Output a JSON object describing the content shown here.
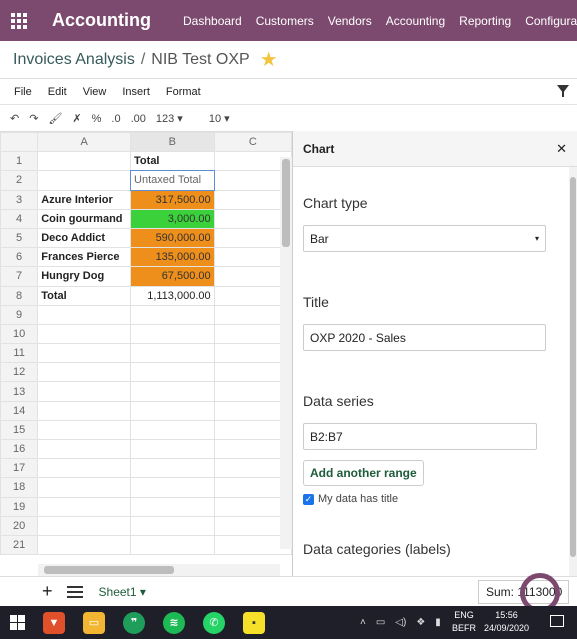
{
  "app": {
    "title": "Accounting",
    "nav": [
      "Dashboard",
      "Customers",
      "Vendors",
      "Accounting",
      "Reporting",
      "Configurati"
    ]
  },
  "breadcrumb": {
    "parent": "Invoices Analysis",
    "separator": "/",
    "current": "NIB Test OXP"
  },
  "menu": [
    "File",
    "Edit",
    "View",
    "Insert",
    "Format"
  ],
  "toolbar": {
    "percent": "%",
    "dec_less": ".0",
    "dec_more": ".00",
    "format": "123 ▾",
    "font_size": "10 ▾"
  },
  "sheet": {
    "columns": [
      "A",
      "B",
      "C"
    ],
    "rows": [
      {
        "n": "1",
        "a": "",
        "b": "Total"
      },
      {
        "n": "2",
        "a": "",
        "b": "Untaxed Total"
      },
      {
        "n": "3",
        "a": "Azure Interior",
        "b": "317,500.00"
      },
      {
        "n": "4",
        "a": "Coin gourmand",
        "b": "3,000.00"
      },
      {
        "n": "5",
        "a": "Deco Addict",
        "b": "590,000.00"
      },
      {
        "n": "6",
        "a": "Frances Pierce",
        "b": "135,000.00"
      },
      {
        "n": "7",
        "a": "Hungry Dog",
        "b": "67,500.00"
      },
      {
        "n": "8",
        "a": "Total",
        "b": "1,113,000.00"
      },
      {
        "n": "9"
      },
      {
        "n": "10"
      },
      {
        "n": "11"
      },
      {
        "n": "12"
      },
      {
        "n": "13"
      },
      {
        "n": "14"
      },
      {
        "n": "15"
      },
      {
        "n": "16"
      },
      {
        "n": "17"
      },
      {
        "n": "18"
      },
      {
        "n": "19"
      },
      {
        "n": "20"
      },
      {
        "n": "21"
      }
    ]
  },
  "panel": {
    "title": "Chart",
    "chart_type_label": "Chart type",
    "chart_type_value": "Bar",
    "title_label": "Title",
    "title_value": "OXP 2020 - Sales",
    "series_label": "Data series",
    "series_value": "B2:B7",
    "add_range": "Add another range",
    "has_title": "My data has title",
    "categories_label": "Data categories (labels)"
  },
  "bottom": {
    "add": "+",
    "sheet_tab": "Sheet1 ▾",
    "sum": "Sum: 1113000"
  },
  "taskbar": {
    "lang_top": "ENG",
    "lang_bottom": "BEFR",
    "time": "15:56",
    "date": "24/09/2020"
  },
  "colors": {
    "topbar": "#7c4a6e",
    "orange": "#ef8f1b",
    "green": "#3ad13a"
  }
}
